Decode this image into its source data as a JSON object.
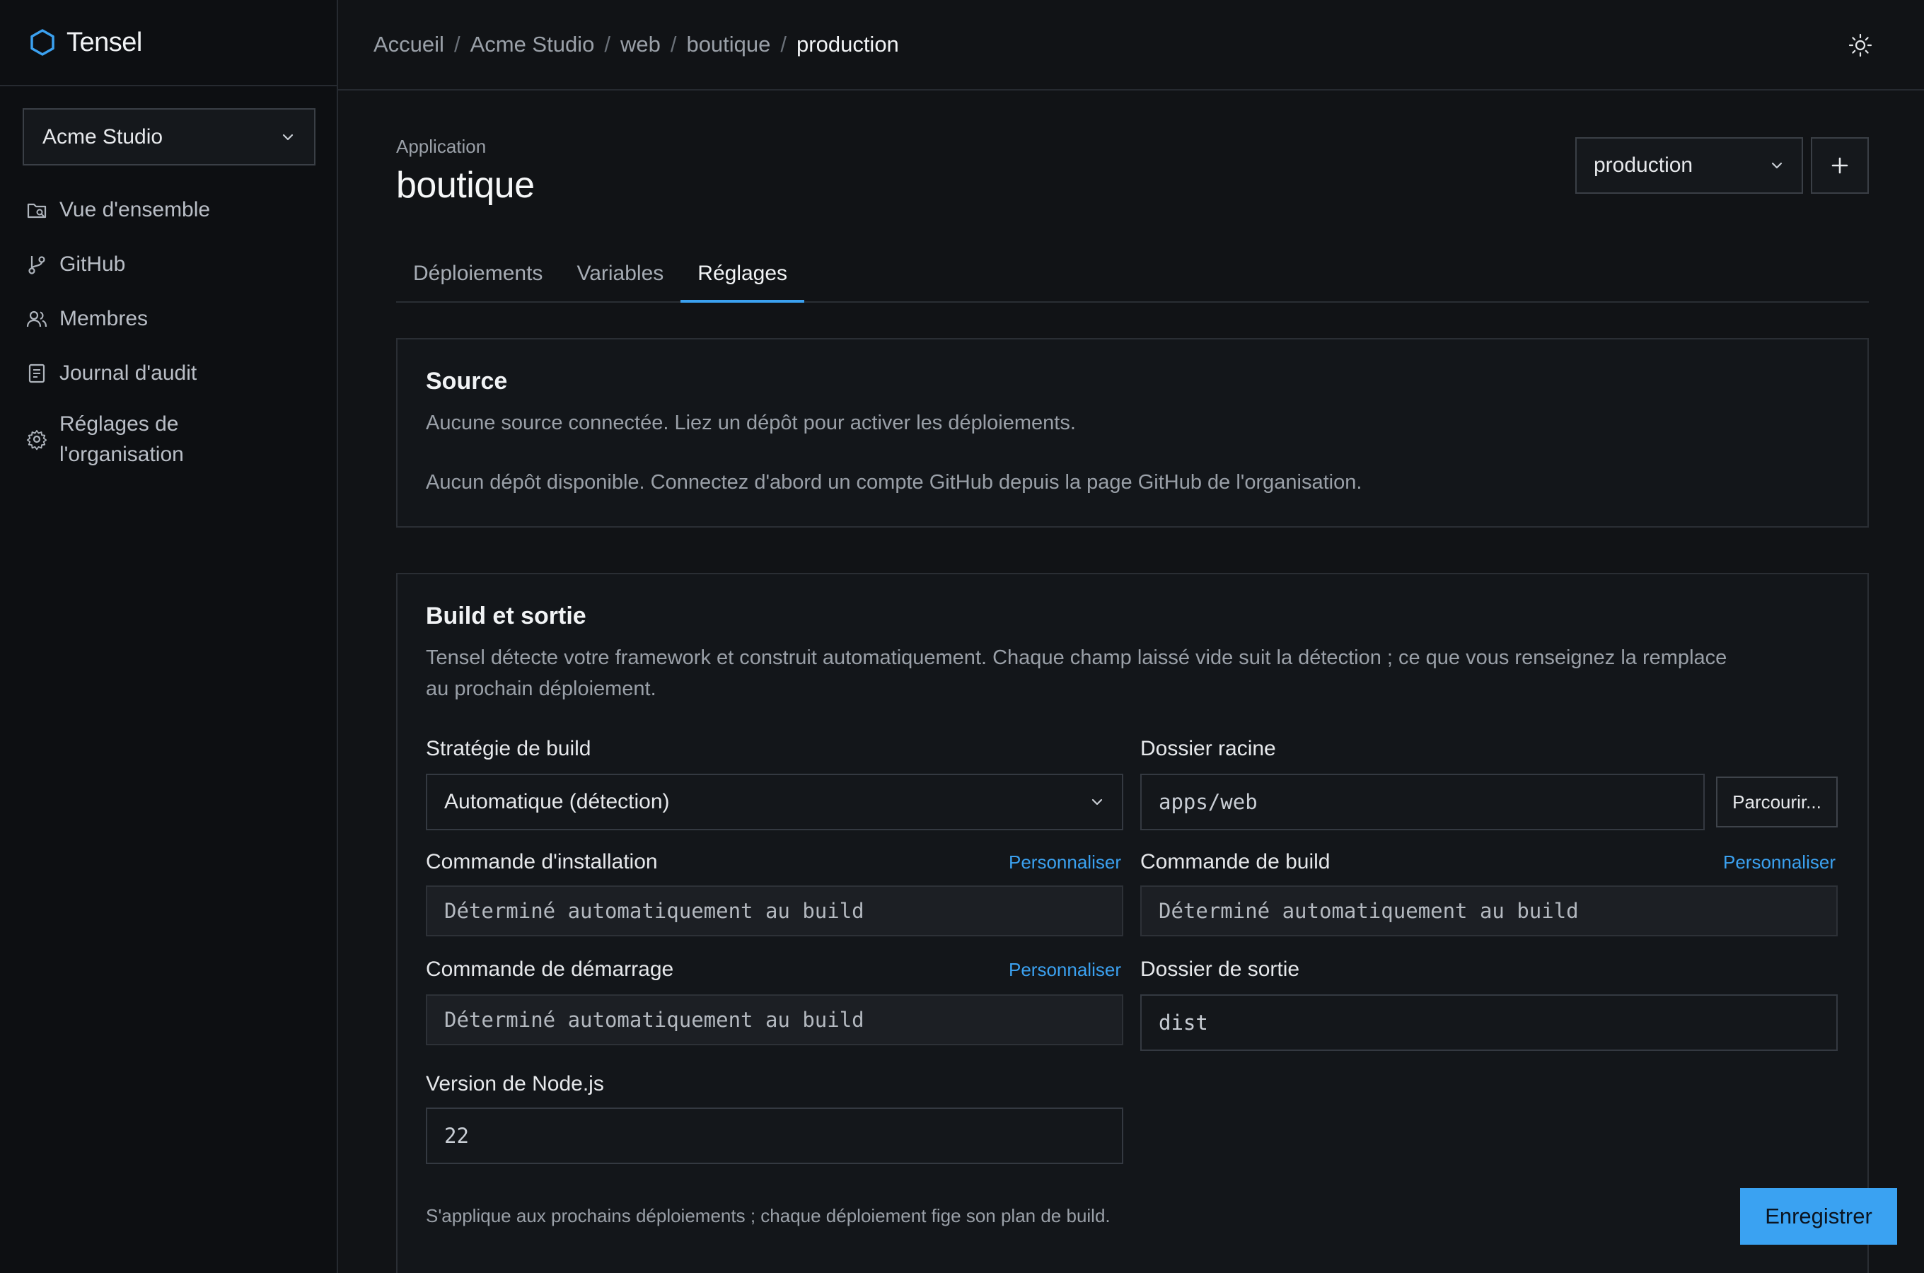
{
  "brand": {
    "name": "Tensel"
  },
  "sidebar": {
    "org_selected": "Acme Studio",
    "items": [
      {
        "label": "Vue d'ensemble",
        "icon": "overview-icon"
      },
      {
        "label": "GitHub",
        "icon": "git-branch-icon"
      },
      {
        "label": "Membres",
        "icon": "users-icon"
      },
      {
        "label": "Journal d'audit",
        "icon": "audit-log-icon"
      },
      {
        "label_line1": "Réglages de",
        "label_line2": "l'organisation",
        "icon": "gear-icon"
      }
    ]
  },
  "breadcrumb": [
    "Accueil",
    "Acme Studio",
    "web",
    "boutique",
    "production"
  ],
  "breadcrumb_separator": "/",
  "page": {
    "kicker": "Application",
    "title": "boutique",
    "env_selected": "production",
    "add_symbol": "+"
  },
  "tabs": [
    {
      "label": "Déploiements",
      "active": false
    },
    {
      "label": "Variables",
      "active": false
    },
    {
      "label": "Réglages",
      "active": true
    }
  ],
  "source": {
    "title": "Source",
    "line1": "Aucune source connectée. Liez un dépôt pour activer les déploiements.",
    "line2": "Aucun dépôt disponible. Connectez d'abord un compte GitHub depuis la page GitHub de l'organisation."
  },
  "build": {
    "title": "Build et sortie",
    "desc_line1": "Tensel détecte votre framework et construit automatiquement. Chaque champ laissé vide suit la détection ; ce que vous renseignez la remplace",
    "desc_line2": "au prochain déploiement.",
    "strategy_label": "Stratégie de build",
    "strategy_value": "Automatique (détection)",
    "root_label": "Dossier racine",
    "root_value": "apps/web",
    "browse_label": "Parcourir...",
    "install_label": "Commande d'installation",
    "install_value": "Déterminé automatiquement au build",
    "build_cmd_label": "Commande de build",
    "build_cmd_value": "Déterminé automatiquement au build",
    "start_label": "Commande de démarrage",
    "start_value": "Déterminé automatiquement au build",
    "output_label": "Dossier de sortie",
    "output_value": "dist",
    "node_label": "Version de Node.js",
    "node_value": "22",
    "customize": "Personnaliser",
    "footnote": "S'applique aux prochains déploiements ; chaque déploiement fige son plan de build.",
    "save": "Enregistrer"
  },
  "colors": {
    "accent": "#3ba1f0",
    "background": "#111316",
    "sidebar": "#0d0f12"
  }
}
